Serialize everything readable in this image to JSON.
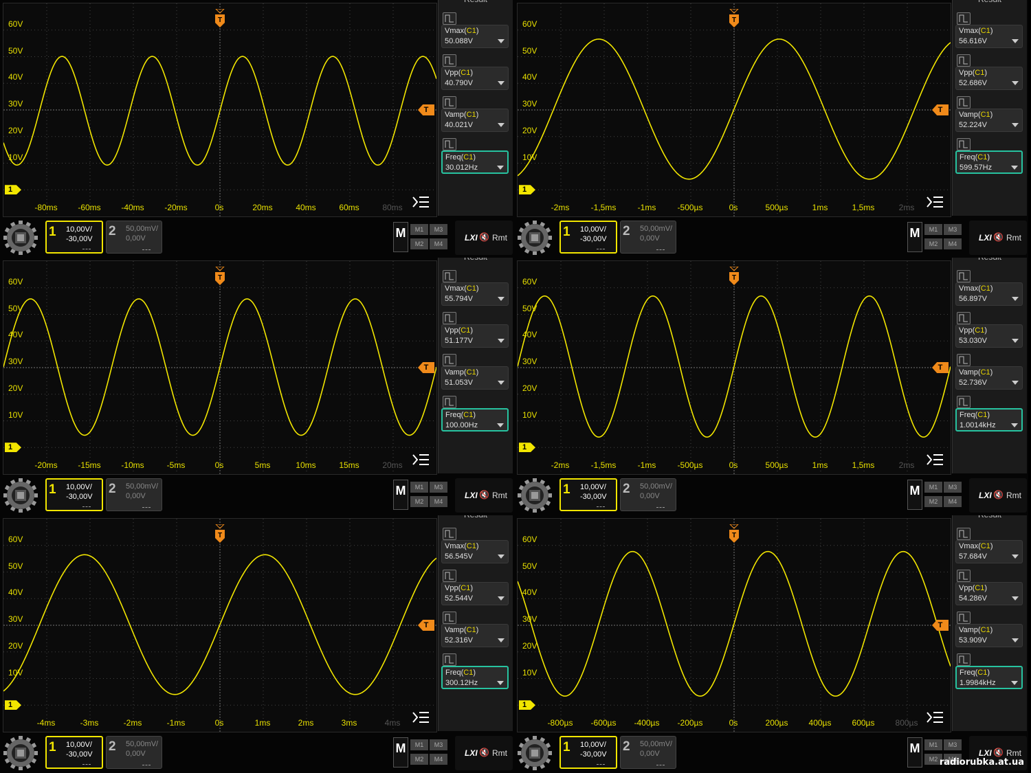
{
  "ui": {
    "y_labels": [
      "60V",
      "50V",
      "40V",
      "30V",
      "20V",
      "10V"
    ],
    "panel_title": "Result",
    "source_tag": "C1",
    "trigger_marker": "T",
    "channel_marker": "1",
    "ch1": {
      "number": "1",
      "scale": "10,00V/",
      "offset": "-30,00V"
    },
    "ch2": {
      "number": "2",
      "scale": "50,00mV/",
      "offset": "0,00V"
    },
    "math": {
      "label": "M",
      "m1": "M1",
      "m2": "M2",
      "m3": "M3",
      "m4": "M4"
    },
    "status": {
      "lxi": "LXI",
      "speaker": "🔇",
      "remote": "Rmt"
    },
    "watermark": "radiorubka.at.ua",
    "colors": {
      "trace": "#f2e600",
      "trigger": "#f08a1a",
      "selected": "#27c3a0"
    }
  },
  "screens": [
    {
      "x_labels": [
        "-80ms",
        "-60ms",
        "-40ms",
        "-20ms",
        "0s",
        "20ms",
        "40ms",
        "60ms",
        "80ms"
      ],
      "measurements": [
        {
          "name": "Vmax",
          "value": "50.088V"
        },
        {
          "name": "Vpp",
          "value": "40.790V"
        },
        {
          "name": "Vamp",
          "value": "40.021V"
        },
        {
          "name": "Freq",
          "value": "30.012Hz"
        }
      ],
      "selected_measurement": "Freq",
      "wave": {
        "cycles_on_screen": 4.8,
        "phase_at_trigger_deg": 0,
        "max_v": 50.1,
        "min_v": 9.3
      }
    },
    {
      "x_labels": [
        "-2ms",
        "-1,5ms",
        "-1ms",
        "-500µs",
        "0s",
        "500µs",
        "1ms",
        "1,5ms",
        "2ms"
      ],
      "measurements": [
        {
          "name": "Vmax",
          "value": "56.616V"
        },
        {
          "name": "Vpp",
          "value": "52.686V"
        },
        {
          "name": "Vamp",
          "value": "52.224V"
        },
        {
          "name": "Freq",
          "value": "599.57Hz"
        }
      ],
      "selected_measurement": "Freq",
      "wave": {
        "cycles_on_screen": 2.4,
        "phase_at_trigger_deg": 0,
        "max_v": 56.6,
        "min_v": 4.0
      }
    },
    {
      "x_labels": [
        "-20ms",
        "-15ms",
        "-10ms",
        "-5ms",
        "0s",
        "5ms",
        "10ms",
        "15ms",
        "20ms"
      ],
      "measurements": [
        {
          "name": "Vmax",
          "value": "55.794V"
        },
        {
          "name": "Vpp",
          "value": "51.177V"
        },
        {
          "name": "Vamp",
          "value": "51.053V"
        },
        {
          "name": "Freq",
          "value": "100.00Hz"
        }
      ],
      "selected_measurement": "Freq",
      "wave": {
        "cycles_on_screen": 4.0,
        "phase_at_trigger_deg": 0,
        "max_v": 55.8,
        "min_v": 4.6
      }
    },
    {
      "x_labels": [
        "-2ms",
        "-1,5ms",
        "-1ms",
        "-500µs",
        "0s",
        "500µs",
        "1ms",
        "1,5ms",
        "2ms"
      ],
      "measurements": [
        {
          "name": "Vmax",
          "value": "56.897V"
        },
        {
          "name": "Vpp",
          "value": "53.030V"
        },
        {
          "name": "Vamp",
          "value": "52.736V"
        },
        {
          "name": "Freq",
          "value": "1.0014kHz"
        }
      ],
      "selected_measurement": "Freq",
      "wave": {
        "cycles_on_screen": 4.0,
        "phase_at_trigger_deg": 0,
        "max_v": 56.9,
        "min_v": 3.9
      }
    },
    {
      "x_labels": [
        "-4ms",
        "-3ms",
        "-2ms",
        "-1ms",
        "0s",
        "1ms",
        "2ms",
        "3ms",
        "4ms"
      ],
      "measurements": [
        {
          "name": "Vmax",
          "value": "56.545V"
        },
        {
          "name": "Vpp",
          "value": "52.544V"
        },
        {
          "name": "Vamp",
          "value": "52.316V"
        },
        {
          "name": "Freq",
          "value": "300.12Hz"
        }
      ],
      "selected_measurement": "Freq",
      "wave": {
        "cycles_on_screen": 2.4,
        "phase_at_trigger_deg": 0,
        "max_v": 56.5,
        "min_v": 4.0
      }
    },
    {
      "x_labels": [
        "-800µs",
        "-600µs",
        "-400µs",
        "-200µs",
        "0s",
        "200µs",
        "400µs",
        "600µs",
        "800µs"
      ],
      "measurements": [
        {
          "name": "Vmax",
          "value": "57.684V"
        },
        {
          "name": "Vpp",
          "value": "54.286V"
        },
        {
          "name": "Vamp",
          "value": "53.909V"
        },
        {
          "name": "Freq",
          "value": "1.9984kHz"
        }
      ],
      "selected_measurement": "Freq",
      "wave": {
        "cycles_on_screen": 3.2,
        "phase_at_trigger_deg": 0,
        "max_v": 57.7,
        "min_v": 3.4
      }
    }
  ]
}
